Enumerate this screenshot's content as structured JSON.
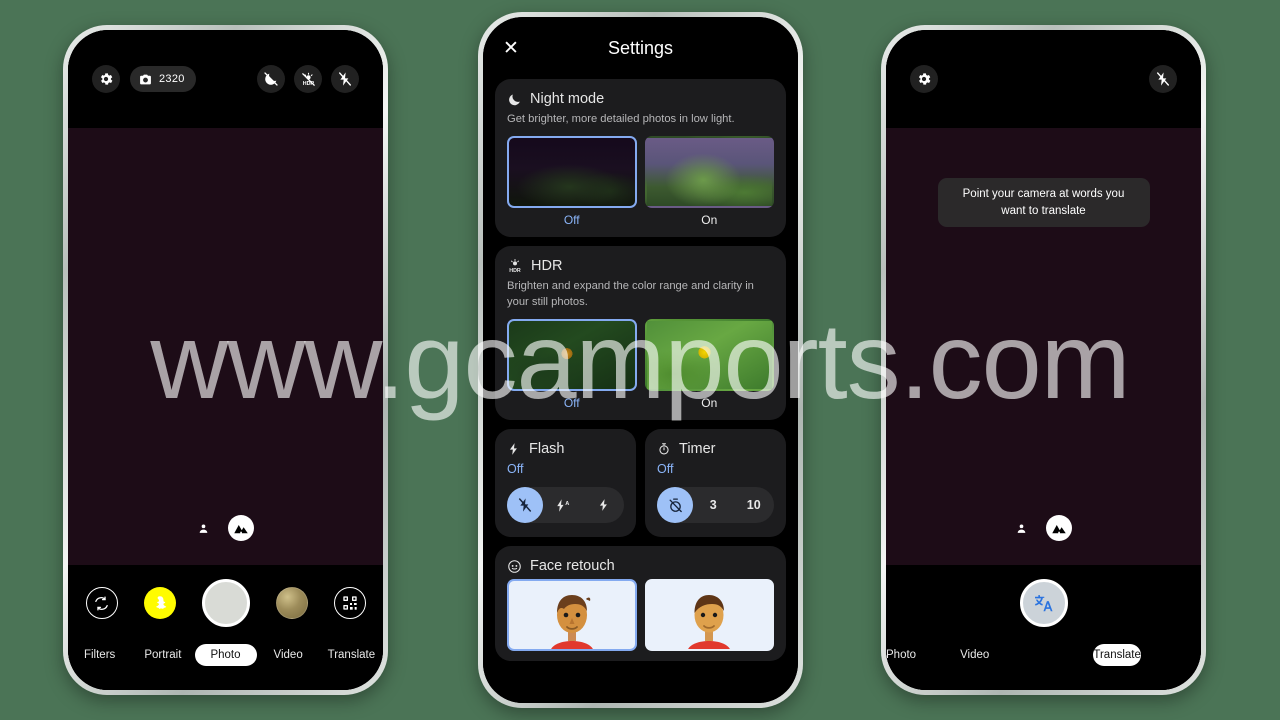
{
  "background_color": "#4b7456",
  "watermark": {
    "text": "www.gcamports.com"
  },
  "phone1": {
    "name": "camera-photo-mode",
    "top_bar": {
      "settings_icon": "gear-icon",
      "shot_counter": "2320",
      "camera_icon": "camera-icon",
      "right_icons": [
        "night-mode-off-icon",
        "hdr-off-icon",
        "flash-off-icon"
      ]
    },
    "viewfinder": {
      "lens_icons": [
        "portrait-marker-icon",
        "landscape-lens-icon"
      ]
    },
    "bottom": {
      "controls": [
        {
          "name": "flip-camera-button",
          "icon": "camera-flip-icon"
        },
        {
          "name": "snapchat-button",
          "icon": "snapchat-ghost-icon"
        },
        {
          "name": "shutter-button",
          "icon": "shutter-icon"
        },
        {
          "name": "gallery-thumbnail",
          "icon": "gallery-thumbnail-icon"
        },
        {
          "name": "qr-scan-button",
          "icon": "qr-code-icon"
        }
      ],
      "modes": [
        "Filters",
        "Portrait",
        "Photo",
        "Video",
        "Translate"
      ],
      "selected_mode": "Photo"
    }
  },
  "phone2": {
    "name": "camera-settings",
    "header": {
      "close_label": "✕",
      "title": "Settings"
    },
    "cards": [
      {
        "id": "night-mode",
        "icon": "moon-icon",
        "title": "Night mode",
        "description": "Get brighter, more detailed photos in low light.",
        "options": [
          {
            "label": "Off",
            "selected": true
          },
          {
            "label": "On",
            "selected": false
          }
        ]
      },
      {
        "id": "hdr",
        "icon": "hdr-icon",
        "title": "HDR",
        "description": "Brighten and expand the color range and clarity in your still photos.",
        "options": [
          {
            "label": "Off",
            "selected": true
          },
          {
            "label": "On",
            "selected": false
          }
        ]
      },
      {
        "id": "face-retouch",
        "icon": "face-retouch-icon",
        "title": "Face retouch",
        "options": [
          {
            "label": "",
            "selected": true
          },
          {
            "label": "",
            "selected": false
          }
        ]
      }
    ],
    "flash": {
      "icon": "flash-icon",
      "title": "Flash",
      "value": "Off",
      "segments": [
        {
          "label": "",
          "icon": "flash-off-icon",
          "selected": true
        },
        {
          "label": "",
          "icon": "flash-auto-icon",
          "selected": false
        },
        {
          "label": "",
          "icon": "flash-on-icon",
          "selected": false
        }
      ]
    },
    "timer": {
      "icon": "timer-icon",
      "title": "Timer",
      "value": "Off",
      "segments": [
        {
          "label": "",
          "icon": "timer-off-icon",
          "selected": true
        },
        {
          "label": "3",
          "icon": "",
          "selected": false
        },
        {
          "label": "10",
          "icon": "",
          "selected": false
        }
      ]
    },
    "accent_color": "#8ab4f8"
  },
  "phone3": {
    "name": "camera-translate-mode",
    "top_bar": {
      "settings_icon": "gear-icon",
      "right_icons": [
        "flash-off-icon"
      ]
    },
    "tooltip": "Point your camera at words you want to translate",
    "viewfinder": {
      "lens_icons": [
        "portrait-marker-icon",
        "landscape-lens-icon"
      ]
    },
    "bottom": {
      "shutter": {
        "name": "translate-shutter-button",
        "icon": "translate-icon"
      },
      "modes": [
        "Photo",
        "Video",
        "Translate"
      ],
      "selected_mode": "Translate"
    }
  }
}
